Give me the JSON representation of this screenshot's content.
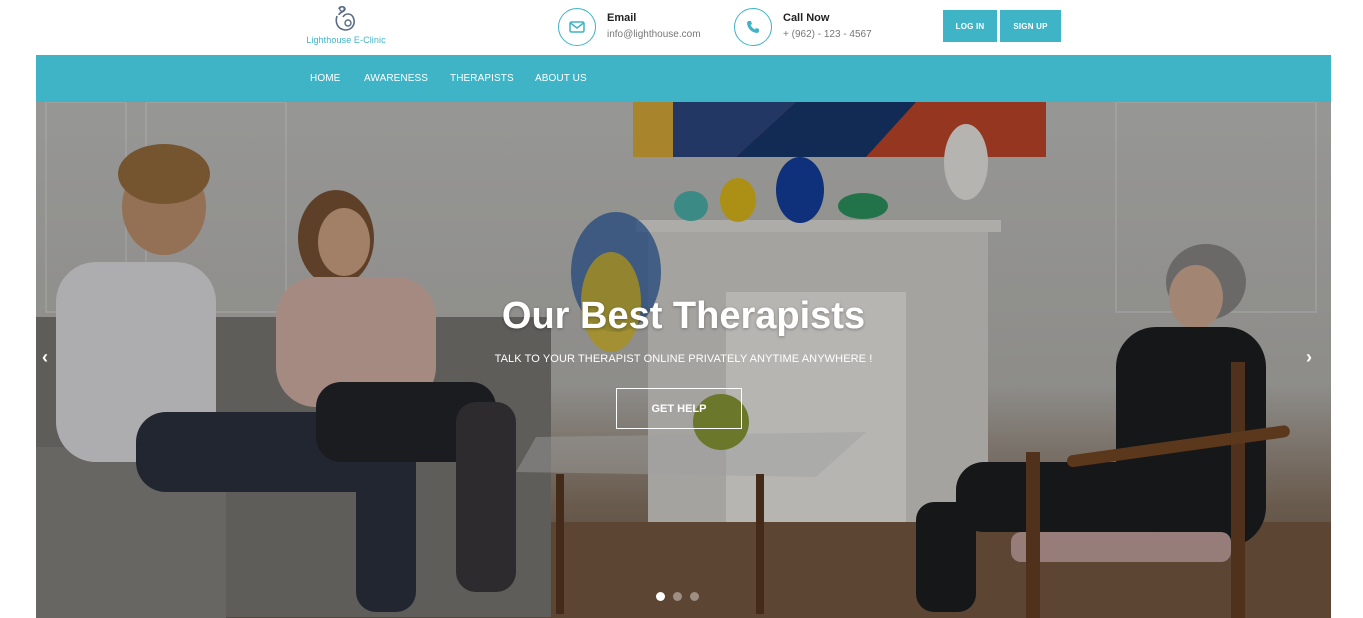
{
  "header": {
    "logo_text": "Lighthouse E-Clinic",
    "email": {
      "title": "Email",
      "value": "info@lighthouse.com",
      "icon": "envelope-icon"
    },
    "phone": {
      "title": "Call Now",
      "value": "+ (962) - 123 - 4567",
      "icon": "phone-icon"
    },
    "login_label": "LOG IN",
    "signup_label": "SIGN UP"
  },
  "nav": {
    "items": [
      {
        "label": "HOME"
      },
      {
        "label": "AWARENESS"
      },
      {
        "label": "THERAPISTS"
      },
      {
        "label": "ABOUT US"
      }
    ]
  },
  "hero": {
    "title": "Our Best Therapists",
    "subtitle": "TALK TO YOUR THERAPIST ONLINE PRIVATELY ANYTIME ANYWHERE !",
    "button_label": "GET HELP",
    "prev_label": "‹",
    "next_label": "›",
    "slide_count": 3,
    "active_slide": 1
  },
  "colors": {
    "accent": "#3fb4c7",
    "white": "#ffffff"
  }
}
